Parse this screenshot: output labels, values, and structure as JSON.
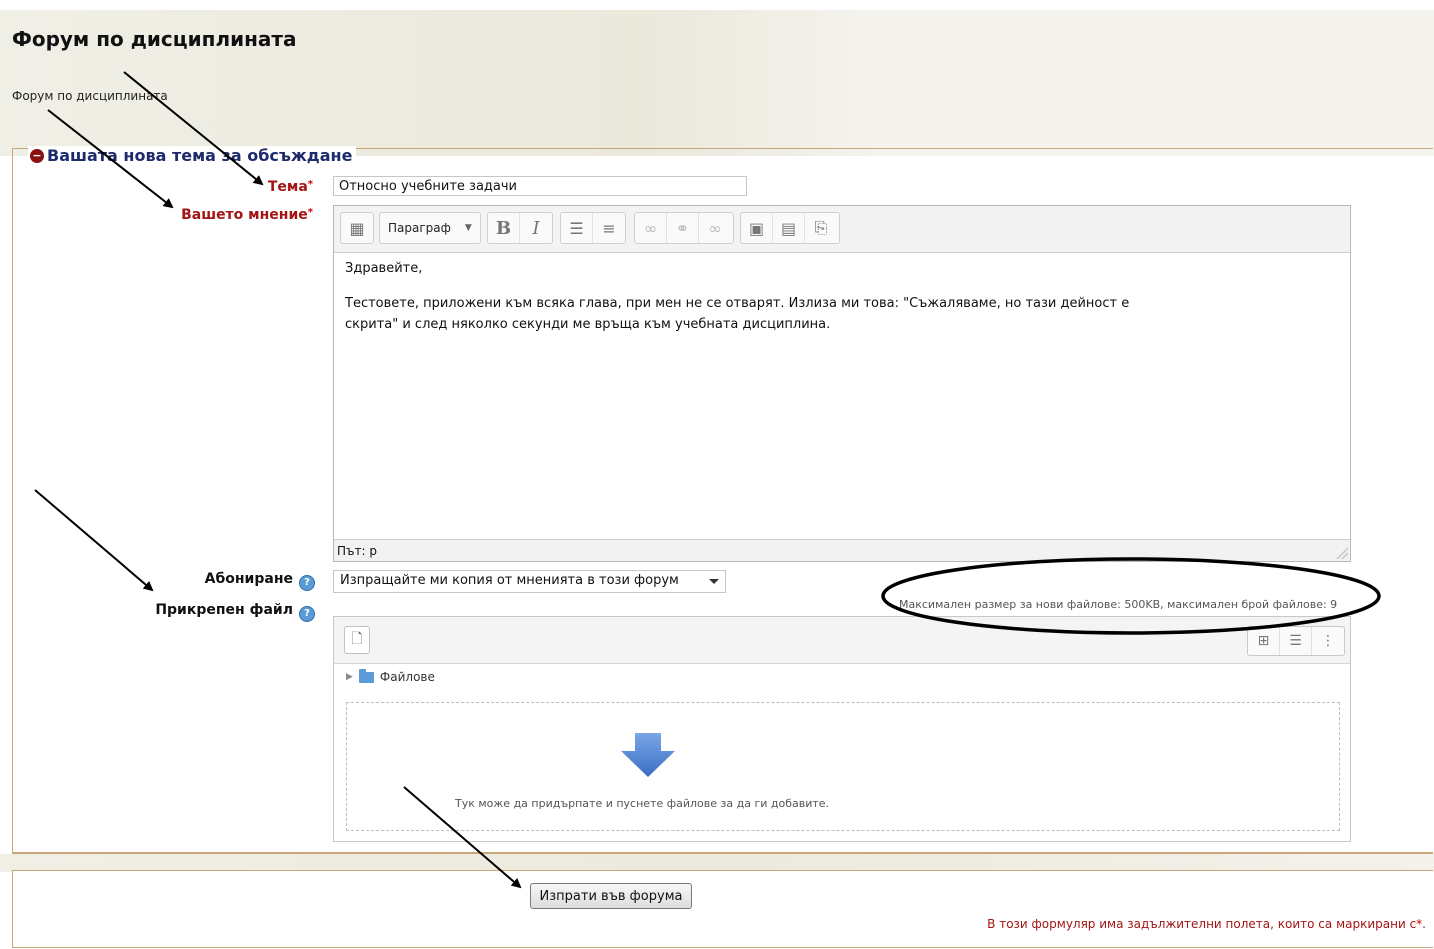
{
  "page": {
    "title": "Форум по дисциплината",
    "description": "Форум по дисциплината"
  },
  "form": {
    "legend": "Вашата нова тема за обсъждане",
    "subject_label": "Тема",
    "subject_value": "Относно учебните задачи",
    "message_label": "Вашето мнение",
    "required_marker": "*",
    "editor": {
      "format_select": "Параграф",
      "buttons": [
        "toolbar-toggle",
        "bold",
        "italic",
        "bullet-list",
        "numbered-list",
        "link",
        "unlink",
        "anchor",
        "image",
        "media",
        "paste"
      ],
      "content_line1": "Здравейте,",
      "content_line2": "Тестовете, приложени към всяка глава, при мен не се отварят. Излиза ми това: \"Съжаляваме, но тази дейност е",
      "content_line3": "скрита\" и след няколко секунди ме връща към учебната дисциплина.",
      "path": "Път: p"
    },
    "subscription_label": "Абониране",
    "subscription_value": "Изпращайте ми копия от мненията в този форум",
    "attachment_label": "Прикрепен файл",
    "attachment_info": "Максимален размер за нови файлове: 500KB, максимален брой файлове: 9",
    "files_folder": "Файлове",
    "dropzone_text": "Тук може да придърпате и пуснете файлове за да ги добавите.",
    "submit_label": "Изпрати във форума",
    "required_note": "В този формуляр има задължителни полета, които са маркирани с",
    "required_note_star": "*",
    "required_note_end": "."
  },
  "colors": {
    "required": "#a31515",
    "legend": "#1d2a6b",
    "border": "#c9a877",
    "annotation": "#000000"
  },
  "icons": [
    "info-collapse-icon",
    "help-icon",
    "add-file-icon",
    "grid-view-icon",
    "list-view-icon",
    "tree-view-icon",
    "folder-icon",
    "download-arrow-icon"
  ]
}
